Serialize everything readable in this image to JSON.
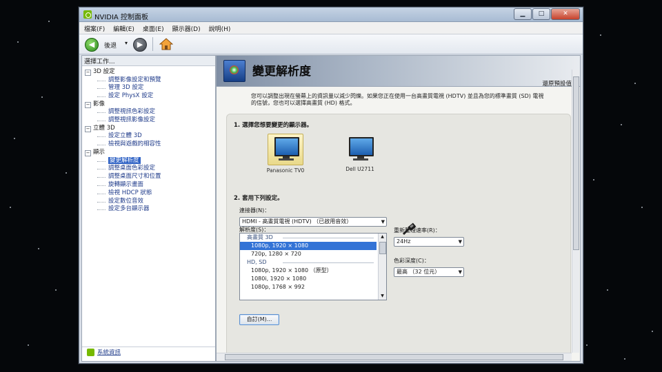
{
  "window": {
    "title": "NVIDIA 控制面板"
  },
  "menu": [
    "檔案(F)",
    "編輯(E)",
    "桌面(E)",
    "顯示器(D)",
    "說明(H)"
  ],
  "toolbar": {
    "back_label": "後退",
    "history_arrow": "▾"
  },
  "left_pane": {
    "header": "選擇工作...",
    "categories": [
      {
        "label": "3D 設定",
        "tasks": [
          "調整影像設定和預覽",
          "管理 3D 設定",
          "設定 PhysX 設定"
        ]
      },
      {
        "label": "影像",
        "tasks": [
          "調整視訊色彩設定",
          "調整視訊影像設定"
        ]
      },
      {
        "label": "立體 3D",
        "tasks": [
          "設定立體 3D",
          "檢視與遊戲的相容性"
        ]
      },
      {
        "label": "顯示",
        "tasks": [
          "變更解析度",
          "調整桌面色彩設定",
          "調整桌面尺寸和位置",
          "旋轉顯示畫面",
          "檢視 HDCP 狀態",
          "設定數位音效",
          "設定多台顯示器"
        ]
      }
    ],
    "system_info": "系統資訊"
  },
  "page": {
    "title": "變更解析度",
    "restore_default": "還原預設值",
    "description_line1": "您可以調整出現在螢幕上的資訊量以減少閃爍。如果您正在使用一台高畫質電視 (HDTV) 並且為您的標準畫質 (SD) 電視",
    "description_line2": "的信號，您也可以選擇高畫質 (HD) 格式。",
    "section1": "1. 選擇您想要變更的顯示器。",
    "displays": [
      {
        "label": "Panasonic TV0",
        "selected": true
      },
      {
        "label": "Dell U2711",
        "selected": false
      }
    ],
    "section2": "2. 套用下列設定。",
    "connector_label": "連接器(N)：",
    "connector_value": "HDMI - 高畫質電視 (HDTV) （已啟用音效）",
    "resolution_label": "解析度(S)：",
    "resolution_groups": [
      {
        "label": "高畫質 3D",
        "items": [
          "1080p, 1920 × 1080",
          "720p, 1280 × 720"
        ]
      },
      {
        "label": "HD, SD",
        "items": [
          "1080p, 1920 × 1080 （原型）",
          "1080i, 1920 × 1080",
          "1080p, 1768 × 992"
        ]
      }
    ],
    "refresh_label": "重新整理速率(R)：",
    "refresh_value": "24Hz",
    "color_depth_label": "色彩深度(C)：",
    "color_depth_value": "最高 （32 位元）",
    "custom_button": "自訂(M)..."
  }
}
